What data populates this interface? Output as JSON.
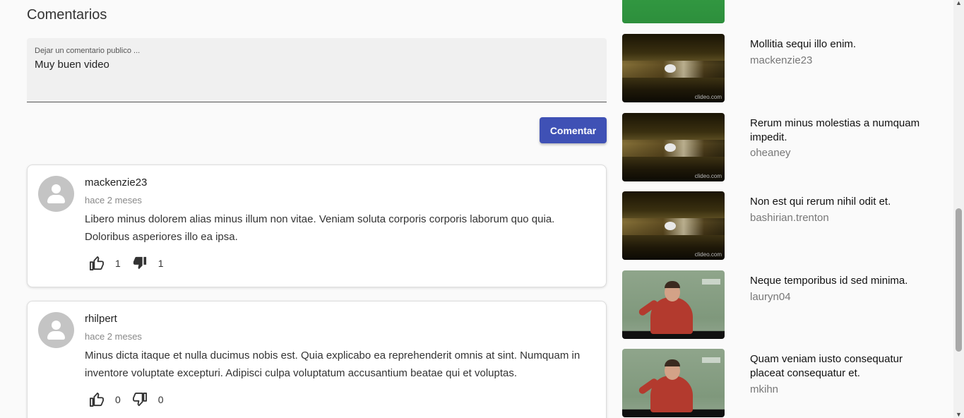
{
  "comments_section": {
    "title": "Comentarios",
    "input_label": "Dejar un comentario publico ...",
    "input_value": "Muy buen video",
    "submit_label": "Comentar",
    "accent_color": "#3f51b5"
  },
  "comments": [
    {
      "author": "mackenzie23",
      "time": "hace 2 meses",
      "text": "Libero minus dolorem alias minus illum non vitae. Veniam soluta corporis corporis laborum quo quia. Doloribus asperiores illo ea ipsa.",
      "likes": "1",
      "dislikes": "1",
      "dislike_active": true
    },
    {
      "author": "rhilpert",
      "time": "hace 2 meses",
      "text": "Minus dicta itaque et nulla ducimus nobis est. Quia explicabo ea reprehenderit omnis at sint. Numquam in inventore voluptate excepturi. Adipisci culpa voluptatum accusantium beatae qui et voluptas.",
      "likes": "0",
      "dislikes": "0",
      "dislike_active": false
    }
  ],
  "related_videos": [
    {
      "title": "Mollitia sequi illo enim.",
      "channel": "mackenzie23",
      "thumbnail": "dark"
    },
    {
      "title": "Rerum minus molestias a numquam impedit.",
      "channel": "oheaney",
      "thumbnail": "dark"
    },
    {
      "title": "Non est qui rerum nihil odit et.",
      "channel": "bashirian.trenton",
      "thumbnail": "dark"
    },
    {
      "title": "Neque temporibus id sed minima.",
      "channel": "lauryn04",
      "thumbnail": "field"
    },
    {
      "title": "Quam veniam iusto consequatur placeat consequatur et.",
      "channel": "mkihn",
      "thumbnail": "field"
    }
  ],
  "thumbnail_watermark": "clideo.com"
}
